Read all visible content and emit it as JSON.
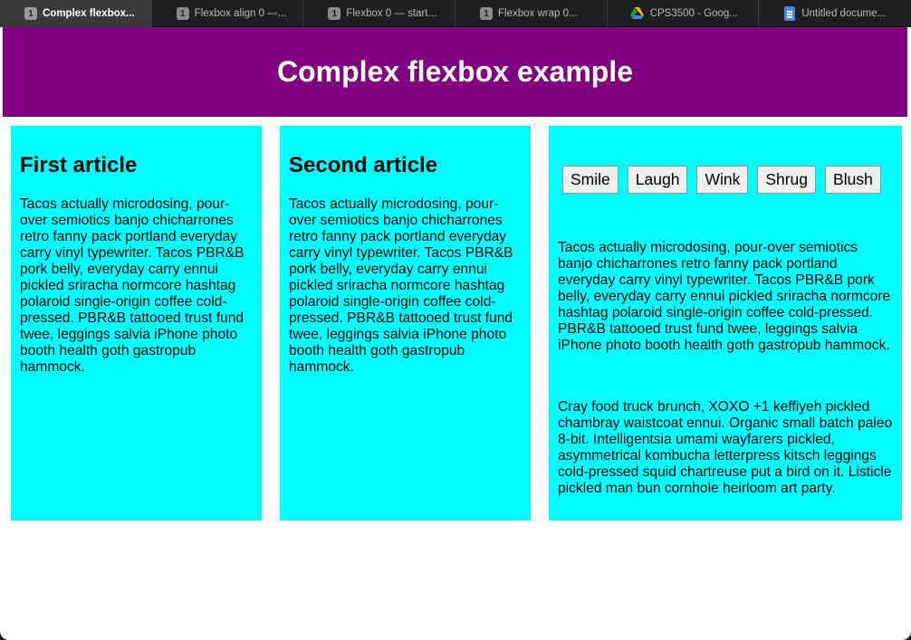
{
  "browser": {
    "tabs": [
      {
        "badge": "1",
        "title": "Complex flexbox..."
      },
      {
        "badge": "1",
        "title": "Flexbox align 0 —..."
      },
      {
        "badge": "1",
        "title": "Flexbox 0 — start..."
      },
      {
        "badge": "1",
        "title": "Flexbox wrap 0..."
      },
      {
        "icon": "google-drive-icon",
        "title": "CPS3500 - Goog..."
      },
      {
        "icon": "google-docs-icon",
        "title": "Untitled docume..."
      }
    ]
  },
  "page": {
    "title": "Complex flexbox example",
    "colors": {
      "header": "#800080",
      "article": "#00ffff"
    },
    "articles": [
      {
        "heading": "First article",
        "body": "Tacos actually microdosing, pour-over semiotics banjo chicharrones retro fanny pack portland everyday carry vinyl typewriter. Tacos PBR&B pork belly, everyday carry ennui pickled sriracha normcore hashtag polaroid single-origin coffee cold-pressed. PBR&B tattooed trust fund twee, leggings salvia iPhone photo booth health goth gastropub hammock."
      },
      {
        "heading": "Second article",
        "body": "Tacos actually microdosing, pour-over semiotics banjo chicharrones retro fanny pack portland everyday carry vinyl typewriter. Tacos PBR&B pork belly, everyday carry ennui pickled sriracha normcore hashtag polaroid single-origin coffee cold-pressed. PBR&B tattooed trust fund twee, leggings salvia iPhone photo booth health goth gastropub hammock."
      },
      {
        "buttons": [
          "Smile",
          "Laugh",
          "Wink",
          "Shrug",
          "Blush"
        ],
        "body1": "Tacos actually microdosing, pour-over semiotics banjo chicharrones retro fanny pack portland everyday carry vinyl typewriter. Tacos PBR&B pork belly, everyday carry ennui pickled sriracha normcore hashtag polaroid single-origin coffee cold-pressed. PBR&B tattooed trust fund twee, leggings salvia iPhone photo booth health goth gastropub hammock.",
        "body2": "Cray food truck brunch, XOXO +1 keffiyeh pickled chambray waistcoat ennui. Organic small batch paleo 8-bit. Intelligentsia umami wayfarers pickled, asymmetrical kombucha letterpress kitsch leggings cold-pressed squid chartreuse put a bird on it. Listicle pickled man bun cornhole heirloom art party."
      }
    ]
  }
}
